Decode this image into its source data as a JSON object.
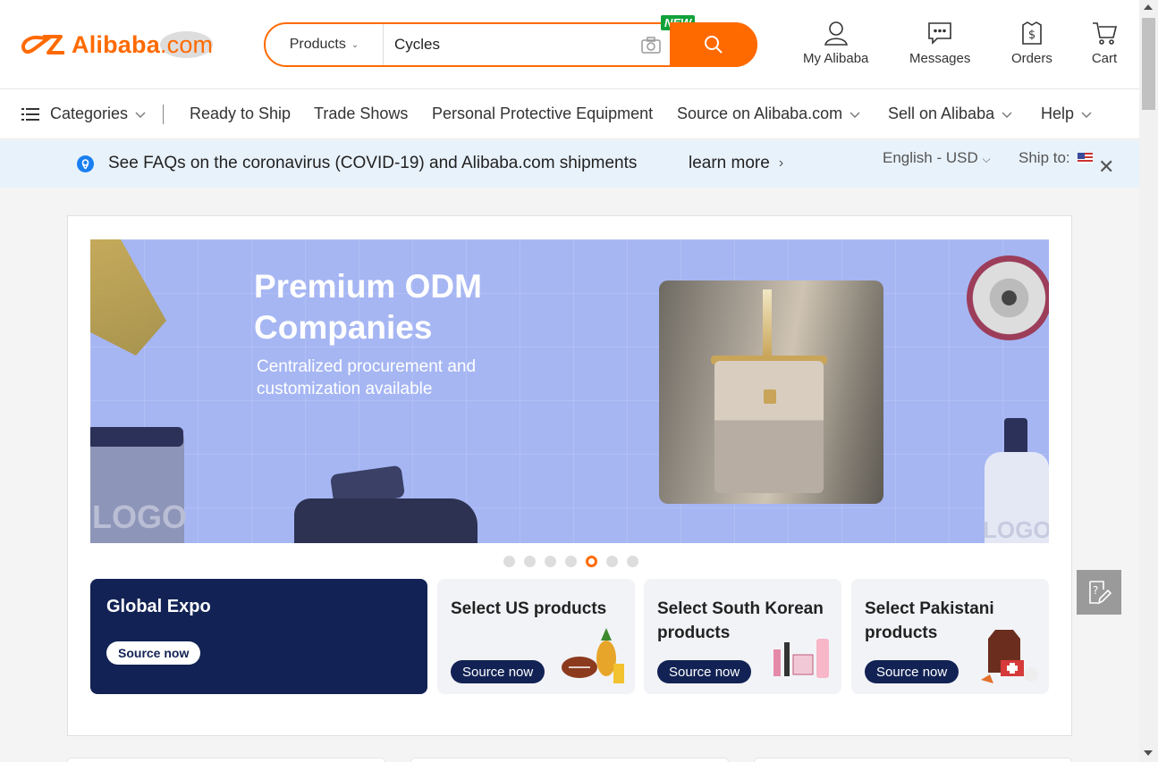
{
  "header": {
    "logo_text": "Alibaba",
    "logo_suffix": ".com",
    "search": {
      "type_label": "Products",
      "value": "Cycles",
      "new_badge": "NEW"
    },
    "links": [
      {
        "label": "My Alibaba",
        "icon": "user-icon"
      },
      {
        "label": "Messages",
        "icon": "messages-icon"
      },
      {
        "label": "Orders",
        "icon": "orders-icon"
      },
      {
        "label": "Cart",
        "icon": "cart-icon"
      }
    ]
  },
  "nav": {
    "categories": "Categories",
    "items": [
      "Ready to Ship",
      "Trade Shows",
      "Personal Protective Equipment",
      "Source on Alibaba.com",
      "Sell on Alibaba",
      "Help"
    ]
  },
  "notice": {
    "text": "See FAQs on the coronavirus (COVID-19) and Alibaba.com shipments",
    "learn_more": "learn more",
    "language": "English - USD",
    "ship_to": "Ship to:"
  },
  "banner": {
    "title_line1": "Premium ODM",
    "title_line2": "Companies",
    "sub_line1": "Centralized procurement and",
    "sub_line2": "customization available",
    "logo_word_left": "LOGO",
    "logo_word_right": "LOGO",
    "dots_total": 7,
    "dots_active_index": 4
  },
  "tiles": [
    {
      "title": "Global Expo",
      "button": "Source now"
    },
    {
      "title": "Select US products",
      "button": "Source now"
    },
    {
      "title": "Select South Korean products",
      "button": "Source now"
    },
    {
      "title": "Select Pakistani products",
      "button": "Source now"
    }
  ],
  "colors": {
    "brand_orange": "#ff6a00",
    "navy": "#122254",
    "notice_bg": "#e8f2fb",
    "banner_bg": "#a6b6f3"
  }
}
